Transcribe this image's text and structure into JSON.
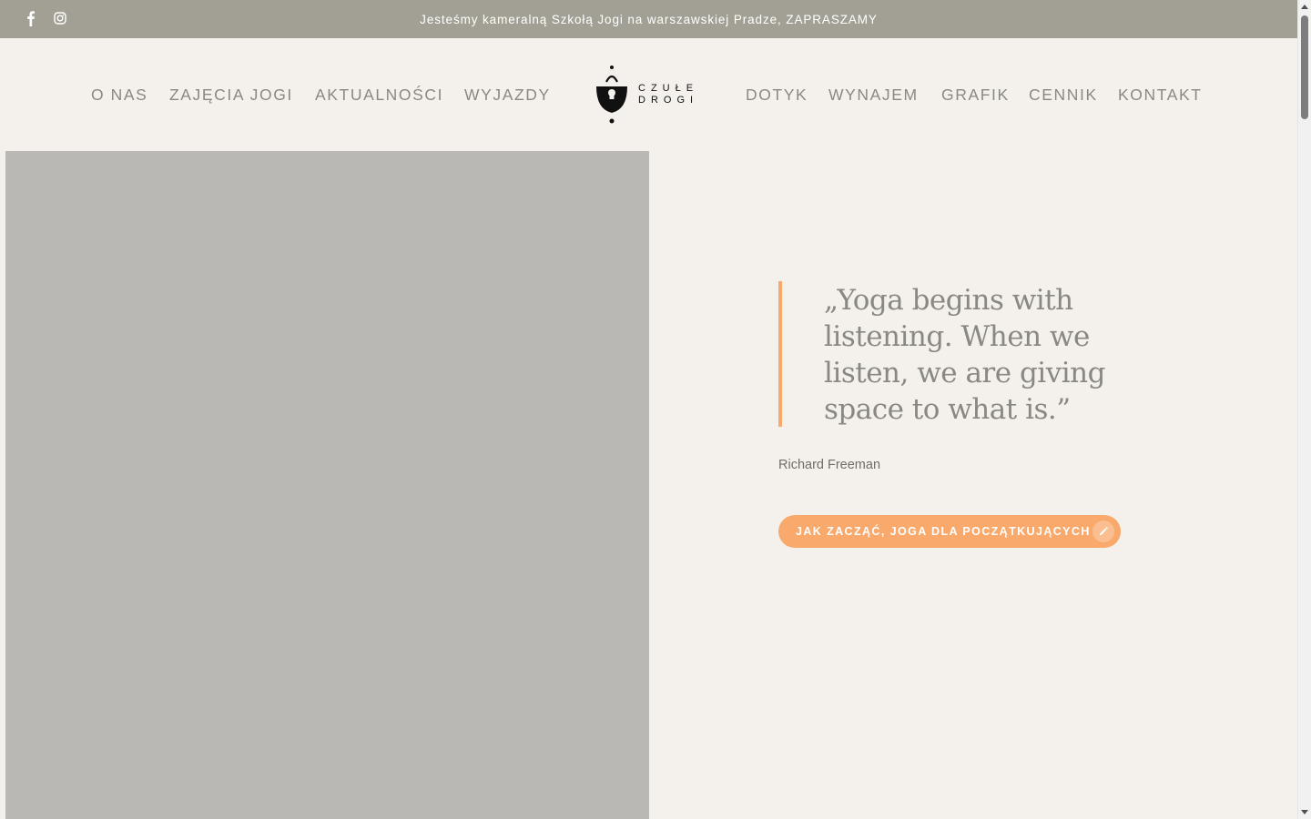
{
  "topbar": {
    "announcement": "Jesteśmy kameralną Szkołą Jogi na warszawskiej Pradze, ZAPRASZAMY",
    "social": [
      {
        "icon": "facebook-icon"
      },
      {
        "icon": "instagram-icon"
      }
    ],
    "background": "#a2a094"
  },
  "nav": {
    "left": [
      "O NAS",
      "ZAJĘCIA JOGI",
      "AKTUALNOŚCI",
      "WYJAZDY"
    ],
    "right": [
      "DOTYK",
      "WYNAJEM",
      "GRAFIK",
      "CENNIK",
      "KONTAKT"
    ]
  },
  "logo": {
    "line1": "CZUŁE",
    "line2": "DROGI"
  },
  "hero": {
    "quote": "„Yoga begins with listening. When we listen, we are giving space to what is.”",
    "author": "Richard Freeman",
    "cta_label": "JAK ZACZĄĆ, JOGA DLA POCZĄTKUJĄCYCH",
    "cta_icon": "pencil-icon"
  },
  "colors": {
    "accent": "#f8a96b",
    "page_bg": "#f4f1ec",
    "image_placeholder": "#b9b8b4",
    "nav_text": "#8a8882"
  }
}
